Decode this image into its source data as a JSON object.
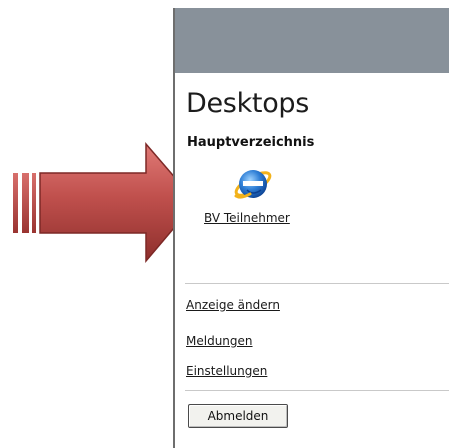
{
  "desktops": {
    "title": "Desktops",
    "section_heading": "Hauptverzeichnis",
    "items": [
      {
        "label": "BV Teilnehmer",
        "icon": "internet-explorer-icon"
      }
    ]
  },
  "menu": {
    "links": [
      {
        "label": "Anzeige ändern"
      },
      {
        "label": "Meldungen"
      },
      {
        "label": "Einstellungen"
      }
    ],
    "logout_label": "Abmelden"
  },
  "colors": {
    "topbar": "#88919a",
    "arrow": "#c0504d"
  }
}
